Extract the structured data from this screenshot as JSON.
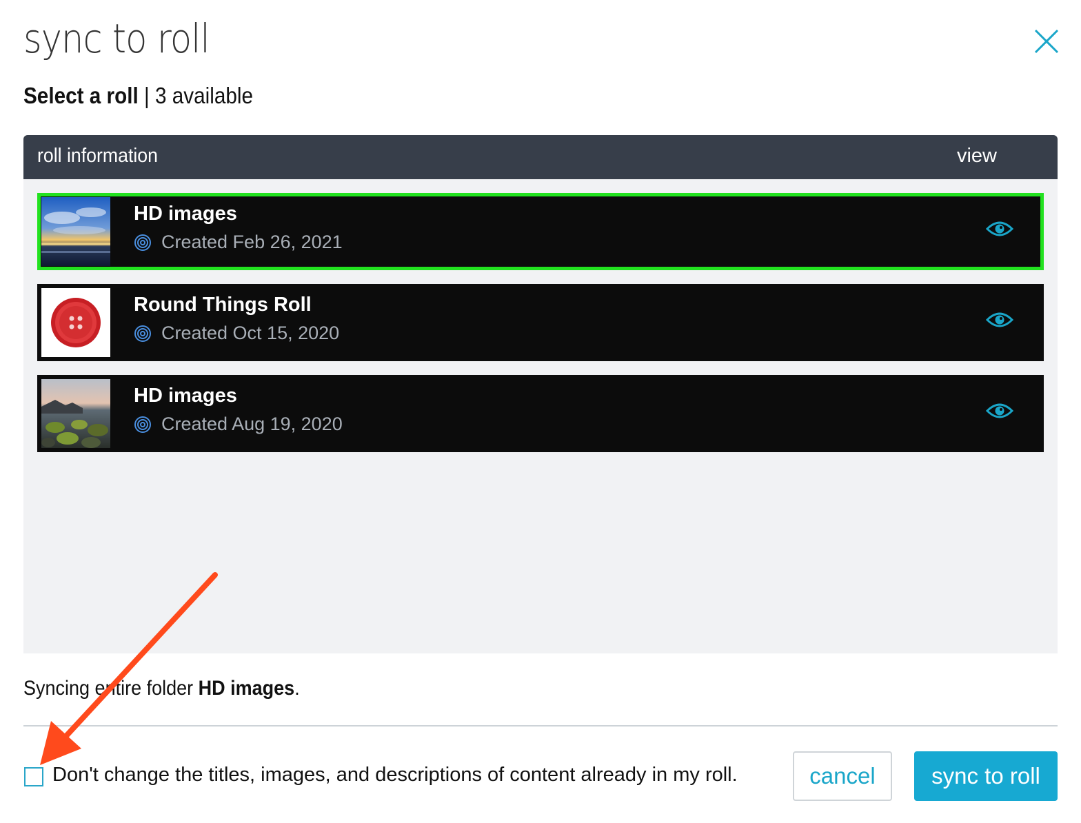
{
  "dialog": {
    "title": "sync to roll",
    "close_label": "close"
  },
  "subtitle": {
    "strong": "Select a roll",
    "separator": " | ",
    "count_text": "3 available"
  },
  "table": {
    "col_info": "roll information",
    "col_view": "view"
  },
  "rolls": [
    {
      "name": "HD images",
      "created": "Created Feb 26, 2021",
      "selected": true,
      "thumb": "sky-sunset-thumbnail"
    },
    {
      "name": "Round Things Roll",
      "created": "Created Oct 15, 2020",
      "selected": false,
      "thumb": "red-button-thumbnail"
    },
    {
      "name": "HD images",
      "created": "Created Aug 19, 2020",
      "selected": false,
      "thumb": "rocky-beach-thumbnail"
    }
  ],
  "sync_note": {
    "prefix": "Syncing entire folder ",
    "folder": "HD images",
    "suffix": "."
  },
  "option": {
    "label": "Don't change the titles, images, and descriptions of content already in my roll.",
    "checked": false
  },
  "actions": {
    "cancel": "cancel",
    "sync": "sync to roll"
  },
  "colors": {
    "accent": "#17a9d2",
    "selected_outline": "#22e21f",
    "header_bg": "#373e4a",
    "row_bg": "#0c0c0c",
    "annotation_arrow": "#ff4a1c"
  }
}
